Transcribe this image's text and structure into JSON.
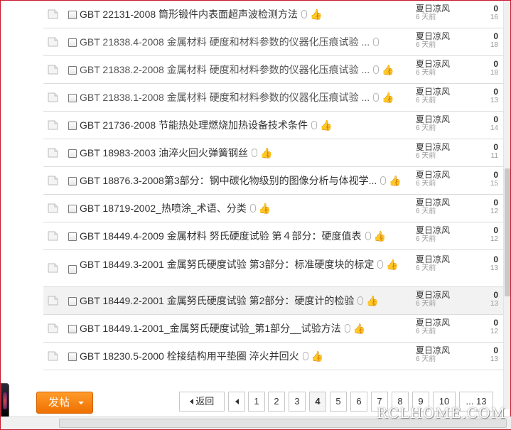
{
  "threads": [
    {
      "title": "GBT 22131-2008 筒形锻件内表面超声波检测方法",
      "attach": true,
      "thumb": true,
      "author": "夏日凉风",
      "time": "6 天前",
      "replies": "0",
      "views": "16",
      "gray": false
    },
    {
      "title": "GBT 21838.4-2008 金属材料  硬度和材料参数的仪器化压痕试验  ...",
      "attach": true,
      "thumb": false,
      "author": "夏日凉风",
      "time": "6 天前",
      "replies": "0",
      "views": "18",
      "gray": true
    },
    {
      "title": "GBT 21838.2-2008 金属材料  硬度和材料参数的仪器化压痕试验  ...",
      "attach": true,
      "thumb": true,
      "author": "夏日凉风",
      "time": "6 天前",
      "replies": "0",
      "views": "18",
      "gray": true
    },
    {
      "title": "GBT 21838.1-2008 金属材料  硬度和材料参数的仪器化压痕试验  ...",
      "attach": true,
      "thumb": true,
      "author": "夏日凉风",
      "time": "6 天前",
      "replies": "0",
      "views": "13",
      "gray": true
    },
    {
      "title": "GBT 21736-2008 节能热处理燃烧加热设备技术条件",
      "attach": true,
      "thumb": true,
      "author": "夏日凉风",
      "time": "6 天前",
      "replies": "0",
      "views": "14",
      "gray": false
    },
    {
      "title": "GBT 18983-2003 油淬火回火弹簧钢丝",
      "attach": true,
      "thumb": true,
      "author": "夏日凉风",
      "time": "6 天前",
      "replies": "0",
      "views": "11",
      "gray": false
    },
    {
      "title": "GBT 18876.3-2008第3部分：钢中碳化物级别的图像分析与体视学...",
      "attach": true,
      "thumb": true,
      "author": "夏日凉风",
      "time": "6 天前",
      "replies": "0",
      "views": "15",
      "gray": false
    },
    {
      "title": "GBT 18719-2002_热喷涂_术语、分类",
      "attach": true,
      "thumb": true,
      "author": "夏日凉风",
      "time": "6 天前",
      "replies": "0",
      "views": "12",
      "gray": false
    },
    {
      "title": "GBT 18449.4-2009 金属材料  努氏硬度试验  第４部分：硬度值表",
      "attach": true,
      "thumb": true,
      "author": "夏日凉风",
      "time": "6 天前",
      "replies": "0",
      "views": "12",
      "gray": false
    },
    {
      "title": "GBT 18449.3-2001 金属努氏硬度试验  第3部分：标准硬度块的标定",
      "attach": true,
      "thumb": true,
      "author": "夏日凉风",
      "time": "6 天前",
      "replies": "0",
      "views": "13",
      "gray": false,
      "tall": true
    },
    {
      "title": "GBT 18449.2-2001 金属努氏硬度试验  第2部分：硬度计的检验",
      "attach": true,
      "thumb": true,
      "author": "夏日凉风",
      "time": "6 天前",
      "replies": "0",
      "views": "13",
      "gray": false,
      "highlight": true
    },
    {
      "title": "GBT 18449.1-2001_金属努氏硬度试验_第1部分__试验方法",
      "attach": true,
      "thumb": true,
      "author": "夏日凉风",
      "time": "6 天前",
      "replies": "0",
      "views": "12",
      "gray": false
    },
    {
      "title": "GBT 18230.5-2000 栓接结构用平垫圈  淬火并回火",
      "attach": true,
      "thumb": true,
      "author": "夏日凉风",
      "time": "6 天前",
      "replies": "0",
      "views": "13",
      "gray": false
    }
  ],
  "post_button": {
    "label": "发帖"
  },
  "pager": {
    "back_label": "返回",
    "pages": [
      "1",
      "2",
      "3",
      "4",
      "5",
      "6",
      "7",
      "8",
      "9",
      "10",
      "... 13"
    ],
    "current": "4"
  },
  "watermark": "RCLHOME.COM",
  "colors": {
    "accent": "#ef7000",
    "frame": "#c9182b",
    "thumb": "#d9914b"
  }
}
